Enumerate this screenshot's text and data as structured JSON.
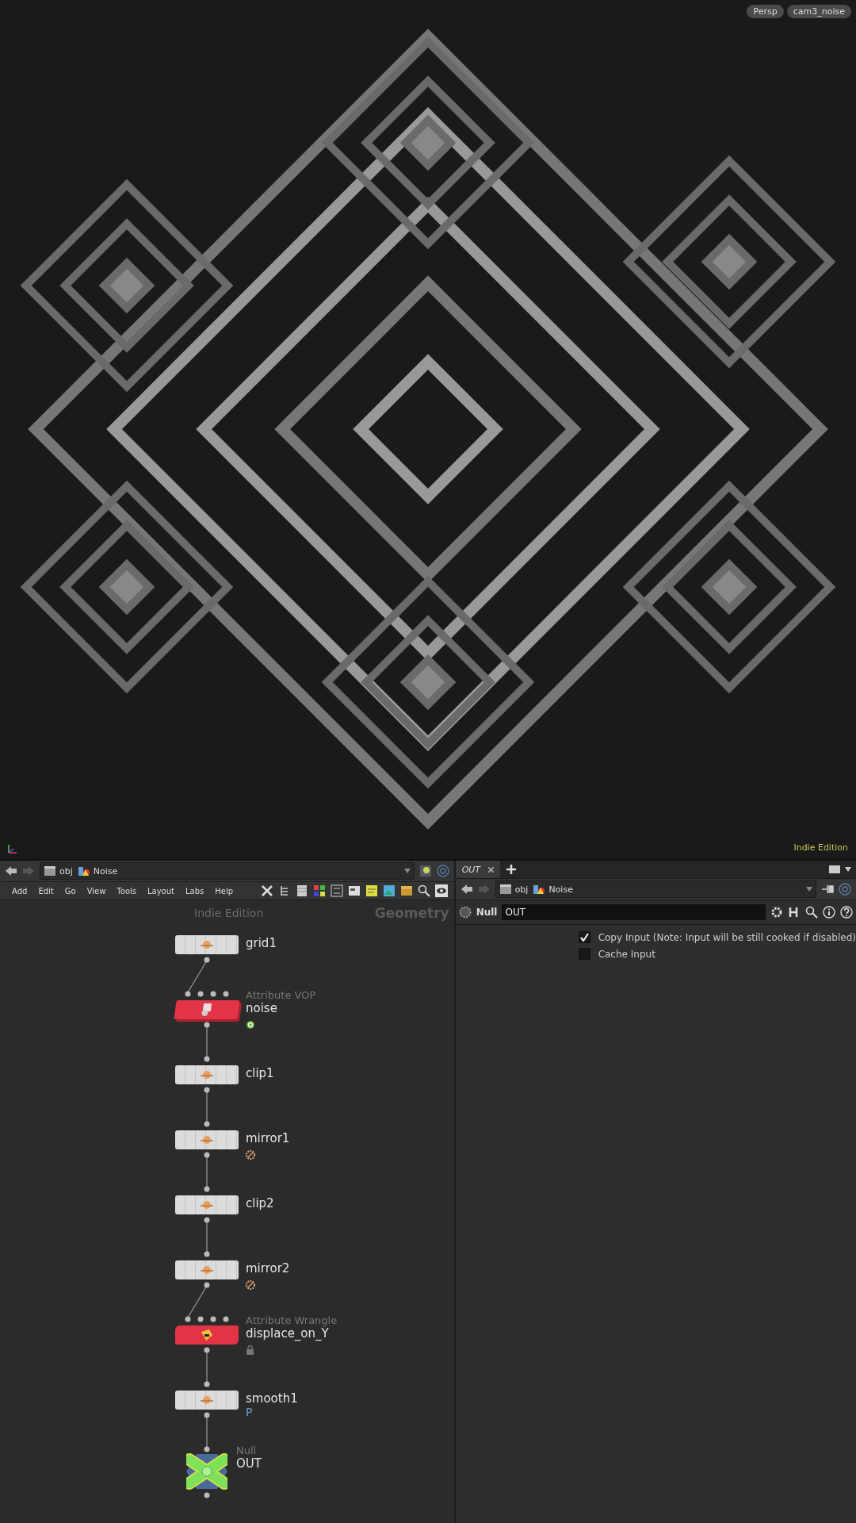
{
  "viewport": {
    "camera_menus": [
      {
        "label": "Persp"
      },
      {
        "label": "cam3_noise"
      }
    ],
    "edition_label": "Indie Edition"
  },
  "network_pane": {
    "path": [
      "obj",
      "Noise"
    ],
    "menu": [
      "Add",
      "Edit",
      "Go",
      "View",
      "Tools",
      "Layout",
      "Labs",
      "Help"
    ],
    "edition_watermark": "Indie Edition",
    "context_label": "Geometry",
    "nodes": [
      {
        "name": "grid1",
        "kind": "sop"
      },
      {
        "name": "noise",
        "type_label": "Attribute VOP",
        "kind": "vop",
        "ringed": true
      },
      {
        "name": "clip1",
        "kind": "sop"
      },
      {
        "name": "mirror1",
        "kind": "sop",
        "bypassed": true
      },
      {
        "name": "clip2",
        "kind": "sop"
      },
      {
        "name": "mirror2",
        "kind": "sop",
        "bypassed": true
      },
      {
        "name": "displace_on_Y",
        "type_label": "Attribute Wrangle",
        "kind": "wrangle",
        "locked": true
      },
      {
        "name": "smooth1",
        "kind": "sop",
        "badge_text": "P"
      },
      {
        "name": "OUT",
        "type_label": "Null",
        "kind": "null"
      }
    ]
  },
  "parameter_pane": {
    "tabs": [
      {
        "label": "OUT",
        "selected": true
      }
    ],
    "path": [
      "obj",
      "Noise"
    ],
    "node_type": "Null",
    "node_name": "OUT",
    "params": [
      {
        "label": "Copy Input (Note: Input will be still cooked if disabled)",
        "checked": true
      },
      {
        "label": "Cache Input",
        "checked": false
      }
    ]
  }
}
